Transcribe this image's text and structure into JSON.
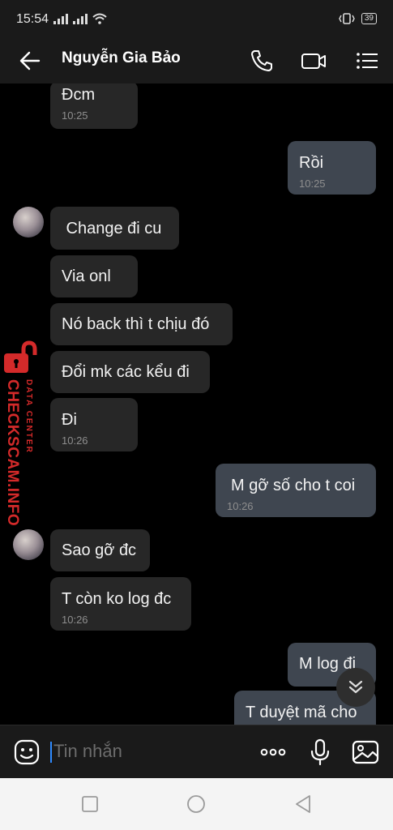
{
  "status_bar": {
    "time": "15:54",
    "battery": "39"
  },
  "header": {
    "contact_name": "Nguyễn Gia Bảo"
  },
  "messages": [
    {
      "side": "in",
      "text": "Đcm",
      "time": "10:25"
    },
    {
      "side": "out",
      "text": "Rồi",
      "time": "10:25"
    },
    {
      "side": "in",
      "text": " Change đi cu",
      "time": ""
    },
    {
      "side": "in",
      "text": "Via onl",
      "time": ""
    },
    {
      "side": "in",
      "text": "Nó back thì t chịu đó",
      "time": ""
    },
    {
      "side": "in",
      "text": "Đổi mk các kểu đi",
      "time": ""
    },
    {
      "side": "in",
      "text": "Đi",
      "time": "10:26"
    },
    {
      "side": "out",
      "text": "M gỡ số cho t coi",
      "time": "10:26"
    },
    {
      "side": "in",
      "text": "Sao gỡ đc",
      "time": ""
    },
    {
      "side": "in",
      "text": "T còn ko log đc",
      "time": "10:26"
    },
    {
      "side": "out",
      "text": "M log đi",
      "time": ""
    },
    {
      "side": "out",
      "text": "T duyệt mã cho",
      "time": ""
    }
  ],
  "watermark": {
    "main": "CHECKSCAM.INFO",
    "sub": "DATA CENTER"
  },
  "composer": {
    "placeholder": "Tin nhắn"
  },
  "icons": {
    "back": "arrow-left-icon",
    "call": "phone-icon",
    "video": "video-camera-icon",
    "menu": "list-menu-icon",
    "sticker": "sticker-smiley-icon",
    "more": "more-dots-icon",
    "mic": "microphone-icon",
    "gallery": "image-gallery-icon",
    "scroll": "chevron-double-down-icon"
  },
  "colors": {
    "incoming_bubble": "#272727",
    "outgoing_bubble": "#3f4650",
    "watermark": "#d42a2a",
    "caret": "#2f8bff"
  }
}
